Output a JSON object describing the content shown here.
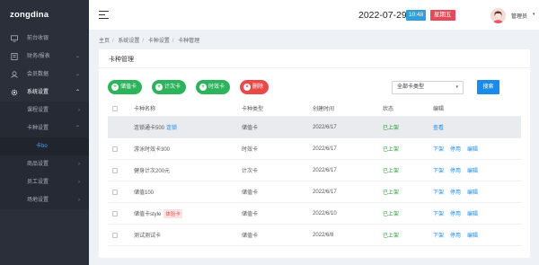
{
  "brand": "zongdina",
  "sidebar": {
    "items": [
      {
        "label": "前台收银",
        "icon": "monitor-icon"
      },
      {
        "label": "财务/报表",
        "icon": "finance-icon"
      },
      {
        "label": "会员数据",
        "icon": "member-icon"
      },
      {
        "label": "系统设置",
        "icon": "gear-icon"
      }
    ],
    "sub_items": [
      {
        "label": "课程设置"
      },
      {
        "label": "卡种设置"
      },
      {
        "label": "卡bo"
      },
      {
        "label": "商品设置"
      },
      {
        "label": "员工设置"
      },
      {
        "label": "场地设置"
      }
    ]
  },
  "header": {
    "date": "2022-07-29",
    "time": "10:48",
    "weekday": "星期五",
    "user": "管理员"
  },
  "breadcrumb": [
    "主页",
    "系统设置",
    "卡种设置",
    "卡种管理"
  ],
  "card": {
    "title": "卡种管理",
    "buttons": {
      "stored": "储值卡",
      "count": "计次卡",
      "time": "时效卡",
      "delete": "删除"
    },
    "select_value": "全部卡类型",
    "search_label": "搜索"
  },
  "table": {
    "headers": {
      "name": "卡种名称",
      "type": "卡种类型",
      "date": "创建时间",
      "status": "状态",
      "ops": "编辑"
    },
    "rows": [
      {
        "name": "连锁通卡500",
        "tag": "连锁",
        "type": "储值卡",
        "date": "2022/6/17",
        "status": "已上架",
        "ops": [
          "查看"
        ]
      },
      {
        "name": "游泳时效卡300",
        "tag": "",
        "type": "时效卡",
        "date": "2022/6/17",
        "status": "已上架",
        "ops": [
          "下架",
          "停用",
          "编辑"
        ]
      },
      {
        "name": "健身计次200元",
        "tag": "",
        "type": "计次卡",
        "date": "2022/6/17",
        "status": "已上架",
        "ops": [
          "下架",
          "停用",
          "编辑"
        ]
      },
      {
        "name": "储值100",
        "tag": "",
        "type": "储值卡",
        "date": "2022/6/17",
        "status": "已上架",
        "ops": [
          "下架",
          "停用",
          "编辑"
        ]
      },
      {
        "name": "储值卡style",
        "tag": "体验卡",
        "type": "储值卡",
        "date": "2022/6/10",
        "status": "已上架",
        "ops": [
          "下架",
          "停用",
          "编辑"
        ]
      },
      {
        "name": "测试测试卡",
        "tag": "",
        "type": "储值卡",
        "date": "2022/6/8",
        "status": "已上架",
        "ops": [
          "下架",
          "停用",
          "编辑"
        ]
      }
    ]
  }
}
